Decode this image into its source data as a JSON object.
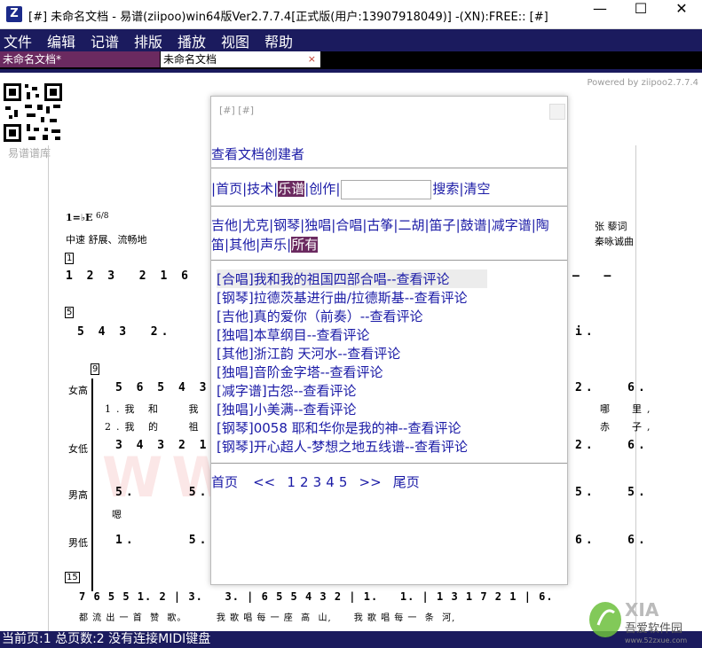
{
  "window": {
    "title": "[#] 未命名文档 - 易谱(ziipoo)win64版Ver2.7.7.4[正式版(用户:13907918049)] -(XN):FREE:: [#]",
    "icon": "Z",
    "minimize": "—",
    "maximize": "☐",
    "close": "✕"
  },
  "menu": [
    "文件",
    "编辑",
    "记谱",
    "排版",
    "播放",
    "视图",
    "帮助"
  ],
  "tabs": [
    {
      "label": "未命名文档*"
    },
    {
      "label": "未命名文档",
      "close": "×"
    }
  ],
  "document": {
    "powered": "Powered by ziipoo2.7.7.4",
    "qr_label": "易谱谱库",
    "key": "1=♭E",
    "time_sig": "6/8",
    "tempo": "中速 舒展、流畅地",
    "lyricist": "张  藜词",
    "composer": "秦咏诚曲",
    "measure_1": "1",
    "measure_5": "5",
    "measure_9": "9",
    "measure_15": "15",
    "line1_notes": "1 2 3  2 1 6",
    "line1_right": "–  –",
    "line2_notes": "5 4 3  2.",
    "line2_right": "i.",
    "soprano_notes": "5 6 5 4 3 2",
    "soprano_right": "2.   6.",
    "alto_notes": "3 4 3 2 1 7",
    "alto_right": "2.   6.",
    "tenor_notes": "5.     5.",
    "tenor_right": "5.   5.",
    "bass_notes": "1.     5.",
    "bass_right": "6.   6.",
    "voice_soprano": "女高",
    "voice_alto": "女低",
    "voice_tenor": "男高",
    "voice_bass": "男低",
    "lyric_1": "1.我 和   我   的",
    "lyric_2": "2.我 的   祖   国",
    "lyric_1_right": "哪  里,",
    "lyric_2_right": "赤  子,",
    "tenor_lyric": "嗯",
    "line5_notes": "7 6 5 5 1. 2 | 3.   3. | 6 5 5 4 3 2 | 1.   1. | 1 3 1 7 2 1 | 6.",
    "line5_lyrics": "都 流 出 一 首  赞  歌。        我 歌 唱 每 一 座  高  山,      我 歌 唱 每 一  条  河,",
    "watermark": "WWW.  .CN"
  },
  "popup": {
    "title": "[#]  [#]",
    "creator_link": "查看文档创建者",
    "nav": [
      "首页",
      "技术",
      "乐谱",
      "创作"
    ],
    "nav_active": "乐谱",
    "search_value": "",
    "search_button": "搜索",
    "clear_button": "清空",
    "categories": [
      "吉他",
      "尤克",
      "钢琴",
      "独唱",
      "合唱",
      "古筝",
      "二胡",
      "笛子",
      "鼓谱",
      "减字谱",
      "陶笛",
      "其他",
      "声乐",
      "所有"
    ],
    "category_active": "所有",
    "results": [
      "[合唱]我和我的祖国四部合唱--查看评论",
      "[钢琴]拉德茨基进行曲/拉德斯基--查看评论",
      "[吉他]真的爱你（前奏）--查看评论",
      "[独唱]本草纲目--查看评论",
      "[其他]浙江韵 天河水--查看评论",
      "[独唱]音阶金字塔--查看评论",
      "[减字谱]古怨--查看评论",
      "[独唱]小美满--查看评论",
      "[钢琴]0058    耶和华你是我的神--查看评论",
      "[钢琴]开心超人-梦想之地五线谱--查看评论"
    ],
    "pager": {
      "first": "首页",
      "prev": "<<",
      "pages": [
        "1",
        "2",
        "3",
        "4",
        "5"
      ],
      "next": ">>",
      "last": "尾页"
    }
  },
  "status": "当前页:1 总页数:2 没有连接MIDI键盘",
  "corner_logo_text": "吾爱软件园",
  "corner_logo_url": "www.52zxue.com",
  "colors": {
    "menubar": "#1b1b5e",
    "tab_active": "#6b2a60",
    "link": "#1a1aa6"
  }
}
